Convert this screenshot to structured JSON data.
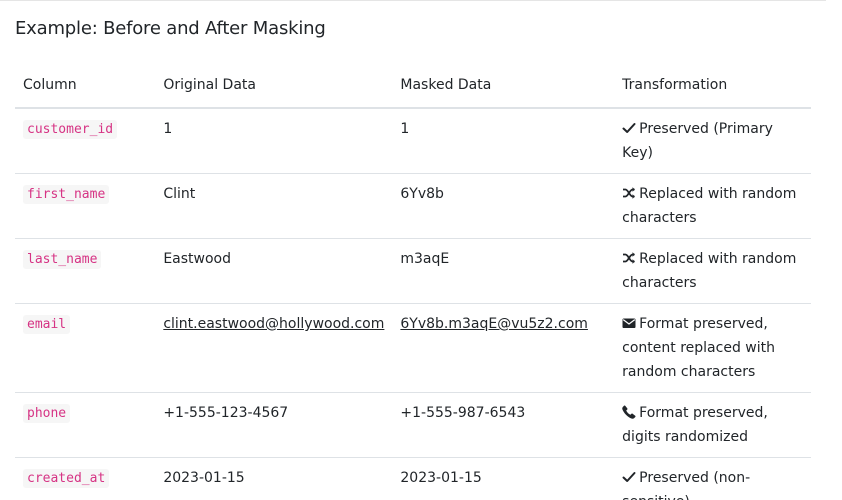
{
  "section": {
    "title": "Example: Before and After Masking"
  },
  "table": {
    "headers": [
      "Column",
      "Original Data",
      "Masked Data",
      "Transformation"
    ],
    "rows": [
      {
        "column": "customer_id",
        "original": "1",
        "masked": "1",
        "transformation_icon": "check-icon",
        "transformation": "Preserved (Primary Key)"
      },
      {
        "column": "first_name",
        "original": "Clint",
        "masked": "6Yv8b",
        "transformation_icon": "shuffle-icon",
        "transformation": "Replaced with random characters"
      },
      {
        "column": "last_name",
        "original": "Eastwood",
        "masked": "m3aqE",
        "transformation_icon": "shuffle-icon",
        "transformation": "Replaced with random characters"
      },
      {
        "column": "email",
        "original": "clint.eastwood@hollywood.com",
        "masked": "6Yv8b.m3aqE@vu5z2.com",
        "transformation_icon": "envelope-icon",
        "transformation": "Format preserved, content replaced with random characters"
      },
      {
        "column": "phone",
        "original": "+1-555-123-4567",
        "masked": "+1-555-987-6543",
        "transformation_icon": "phone-icon",
        "transformation": "Format preserved, digits randomized"
      },
      {
        "column": "created_at",
        "original": "2023-01-15",
        "masked": "2023-01-15",
        "transformation_icon": "check-icon",
        "transformation": "Preserved (non-sensitive)"
      }
    ]
  },
  "colors": {
    "code_text": "#d63384",
    "code_background": "#f6f6f6",
    "border": "#dee2e6",
    "text": "#212529"
  }
}
